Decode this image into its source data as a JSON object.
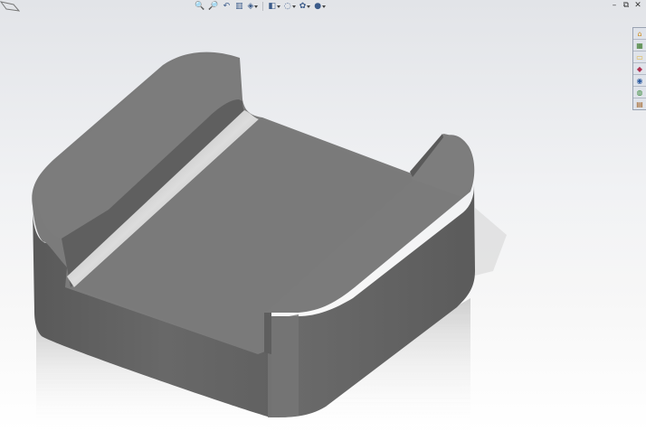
{
  "toolbar": {
    "items": [
      {
        "icon": "zoom-to-fit-icon",
        "glyph": "🔍"
      },
      {
        "icon": "zoom-to-area-icon",
        "glyph": "🔎"
      },
      {
        "icon": "previous-view-icon",
        "glyph": "↶"
      },
      {
        "icon": "section-view-icon",
        "glyph": "▥"
      },
      {
        "icon": "view-orientation-icon",
        "glyph": "◈",
        "dropdown": true
      },
      {
        "icon": "display-style-icon",
        "glyph": "◧",
        "dropdown": true
      },
      {
        "icon": "hide-show-items-icon",
        "glyph": "◌",
        "dropdown": true
      },
      {
        "icon": "edit-appearance-icon",
        "glyph": "✿",
        "dropdown": true
      },
      {
        "icon": "apply-scene-icon",
        "glyph": "●",
        "dropdown": true
      }
    ]
  },
  "window_controls": {
    "minimize": "–",
    "restore": "⧉",
    "close": "✕"
  },
  "task_pane": {
    "tabs": [
      {
        "icon": "resources-icon",
        "glyph": "⌂",
        "color": "#d08a1c"
      },
      {
        "icon": "design-library-icon",
        "glyph": "▦",
        "color": "#3a7a2a"
      },
      {
        "icon": "file-explorer-icon",
        "glyph": "▭",
        "color": "#e0b030"
      },
      {
        "icon": "view-palette-icon",
        "glyph": "◆",
        "color": "#b03050"
      },
      {
        "icon": "appearances-icon",
        "glyph": "◉",
        "color": "#2a5aa0"
      },
      {
        "icon": "custom-properties-icon",
        "glyph": "◍",
        "color": "#3a8a3a"
      },
      {
        "icon": "forum-icon",
        "glyph": "▤",
        "color": "#a06020"
      }
    ]
  },
  "colors": {
    "top_face": "#7b7b7b",
    "wall_dark": "#5f5f5f",
    "wall_mid": "#6a6a6a",
    "floor": "#7a7a7a",
    "background_top": "#e2e4e8",
    "background_bottom": "#ffffff"
  }
}
